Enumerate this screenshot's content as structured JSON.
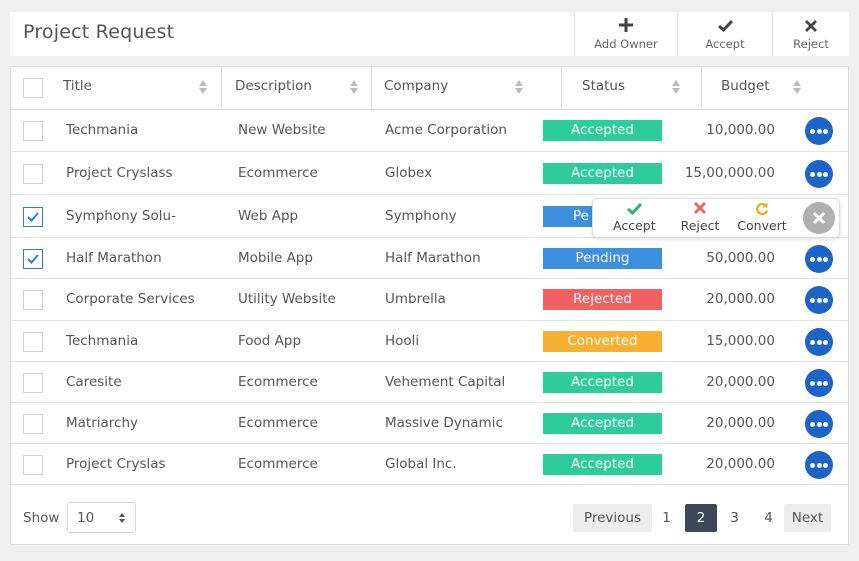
{
  "header": {
    "title": "Project Request",
    "actions": [
      {
        "label": "Add Owner",
        "icon": "plus-icon"
      },
      {
        "label": "Accept",
        "icon": "check-icon"
      },
      {
        "label": "Reject",
        "icon": "x-icon"
      }
    ]
  },
  "table": {
    "columns": [
      "Title",
      "Description",
      "Company",
      "Status",
      "Budget"
    ],
    "rows": [
      {
        "title": "Techmania",
        "description": "New Website",
        "company": "Acme Corporation",
        "status": "Accepted",
        "budget": "10,000.00",
        "checked": false
      },
      {
        "title": "Project Cryslass",
        "description": "Ecommerce",
        "company": "Globex",
        "status": "Accepted",
        "budget": "15,00,000.00",
        "checked": false
      },
      {
        "title": "Symphony Solu-",
        "description": "Web App",
        "company": "Symphony",
        "status": "Pe",
        "budget": "",
        "checked": true
      },
      {
        "title": "Half Marathon",
        "description": "Mobile App",
        "company": "Half Marathon",
        "status": "Pending",
        "budget": "50,000.00",
        "checked": true
      },
      {
        "title": "Corporate Services",
        "description": "Utility Website",
        "company": "Umbrella",
        "status": "Rejected",
        "budget": "20,000.00",
        "checked": false
      },
      {
        "title": "Techmania",
        "description": "Food App",
        "company": "Hooli",
        "status": "Converted",
        "budget": "15,000.00",
        "checked": false
      },
      {
        "title": "Caresite",
        "description": "Ecommerce",
        "company": "Vehement Capital",
        "status": "Accepted",
        "budget": "20,000.00",
        "checked": false
      },
      {
        "title": "Matriarchy",
        "description": "Ecommerce",
        "company": "Massive Dynamic",
        "status": "Accepted",
        "budget": "20,000.00",
        "checked": false
      },
      {
        "title": "Project Cryslas",
        "description": "Ecommerce",
        "company": "Global Inc.",
        "status": "Accepted",
        "budget": "20,000.00",
        "checked": false
      }
    ]
  },
  "status_colors": {
    "Accepted": "#2ecc9b",
    "Pending": "#3d8fdf",
    "Pe": "#3d8fdf",
    "Rejected": "#f26161",
    "Converted": "#f7b032"
  },
  "popover": {
    "items": [
      {
        "label": "Accept",
        "icon": "check-icon",
        "color": "#27b36a"
      },
      {
        "label": "Reject",
        "icon": "x-icon",
        "color": "#f26161"
      },
      {
        "label": "Convert",
        "icon": "refresh-icon",
        "color": "#f0a81a"
      }
    ]
  },
  "footer": {
    "show_label": "Show",
    "page_size": "10",
    "pagination": [
      "Previous",
      "1",
      "2",
      "3",
      "4",
      "Next"
    ],
    "active_page": "2"
  }
}
